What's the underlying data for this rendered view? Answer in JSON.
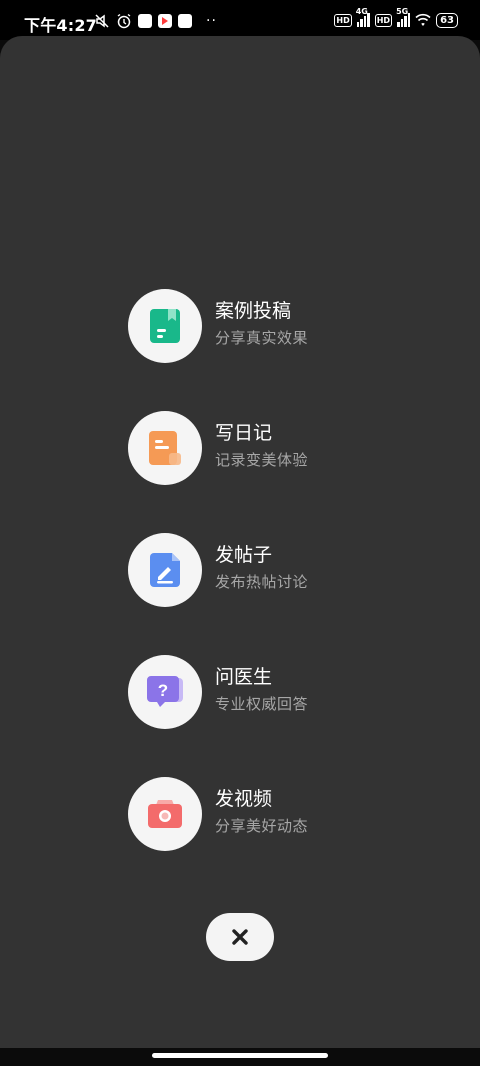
{
  "status_bar": {
    "time": "下午4:27",
    "network_1": "4G",
    "network_2": "5G",
    "hd_1": "HD",
    "hd_2": "HD",
    "battery": "63",
    "more": "··"
  },
  "menu": {
    "items": [
      {
        "title": "案例投稿",
        "subtitle": "分享真实效果",
        "icon": "bookmark-doc-icon",
        "color": "#19b88a"
      },
      {
        "title": "写日记",
        "subtitle": "记录变美体验",
        "icon": "diary-icon",
        "color": "#f59a55"
      },
      {
        "title": "发帖子",
        "subtitle": "发布热帖讨论",
        "icon": "edit-post-icon",
        "color": "#5b8ef0"
      },
      {
        "title": "问医生",
        "subtitle": "专业权威回答",
        "icon": "question-bubble-icon",
        "color": "#8b74e8"
      },
      {
        "title": "发视频",
        "subtitle": "分享美好动态",
        "icon": "camera-icon",
        "color": "#f36b6b"
      }
    ]
  },
  "close": {
    "icon": "close-icon"
  }
}
